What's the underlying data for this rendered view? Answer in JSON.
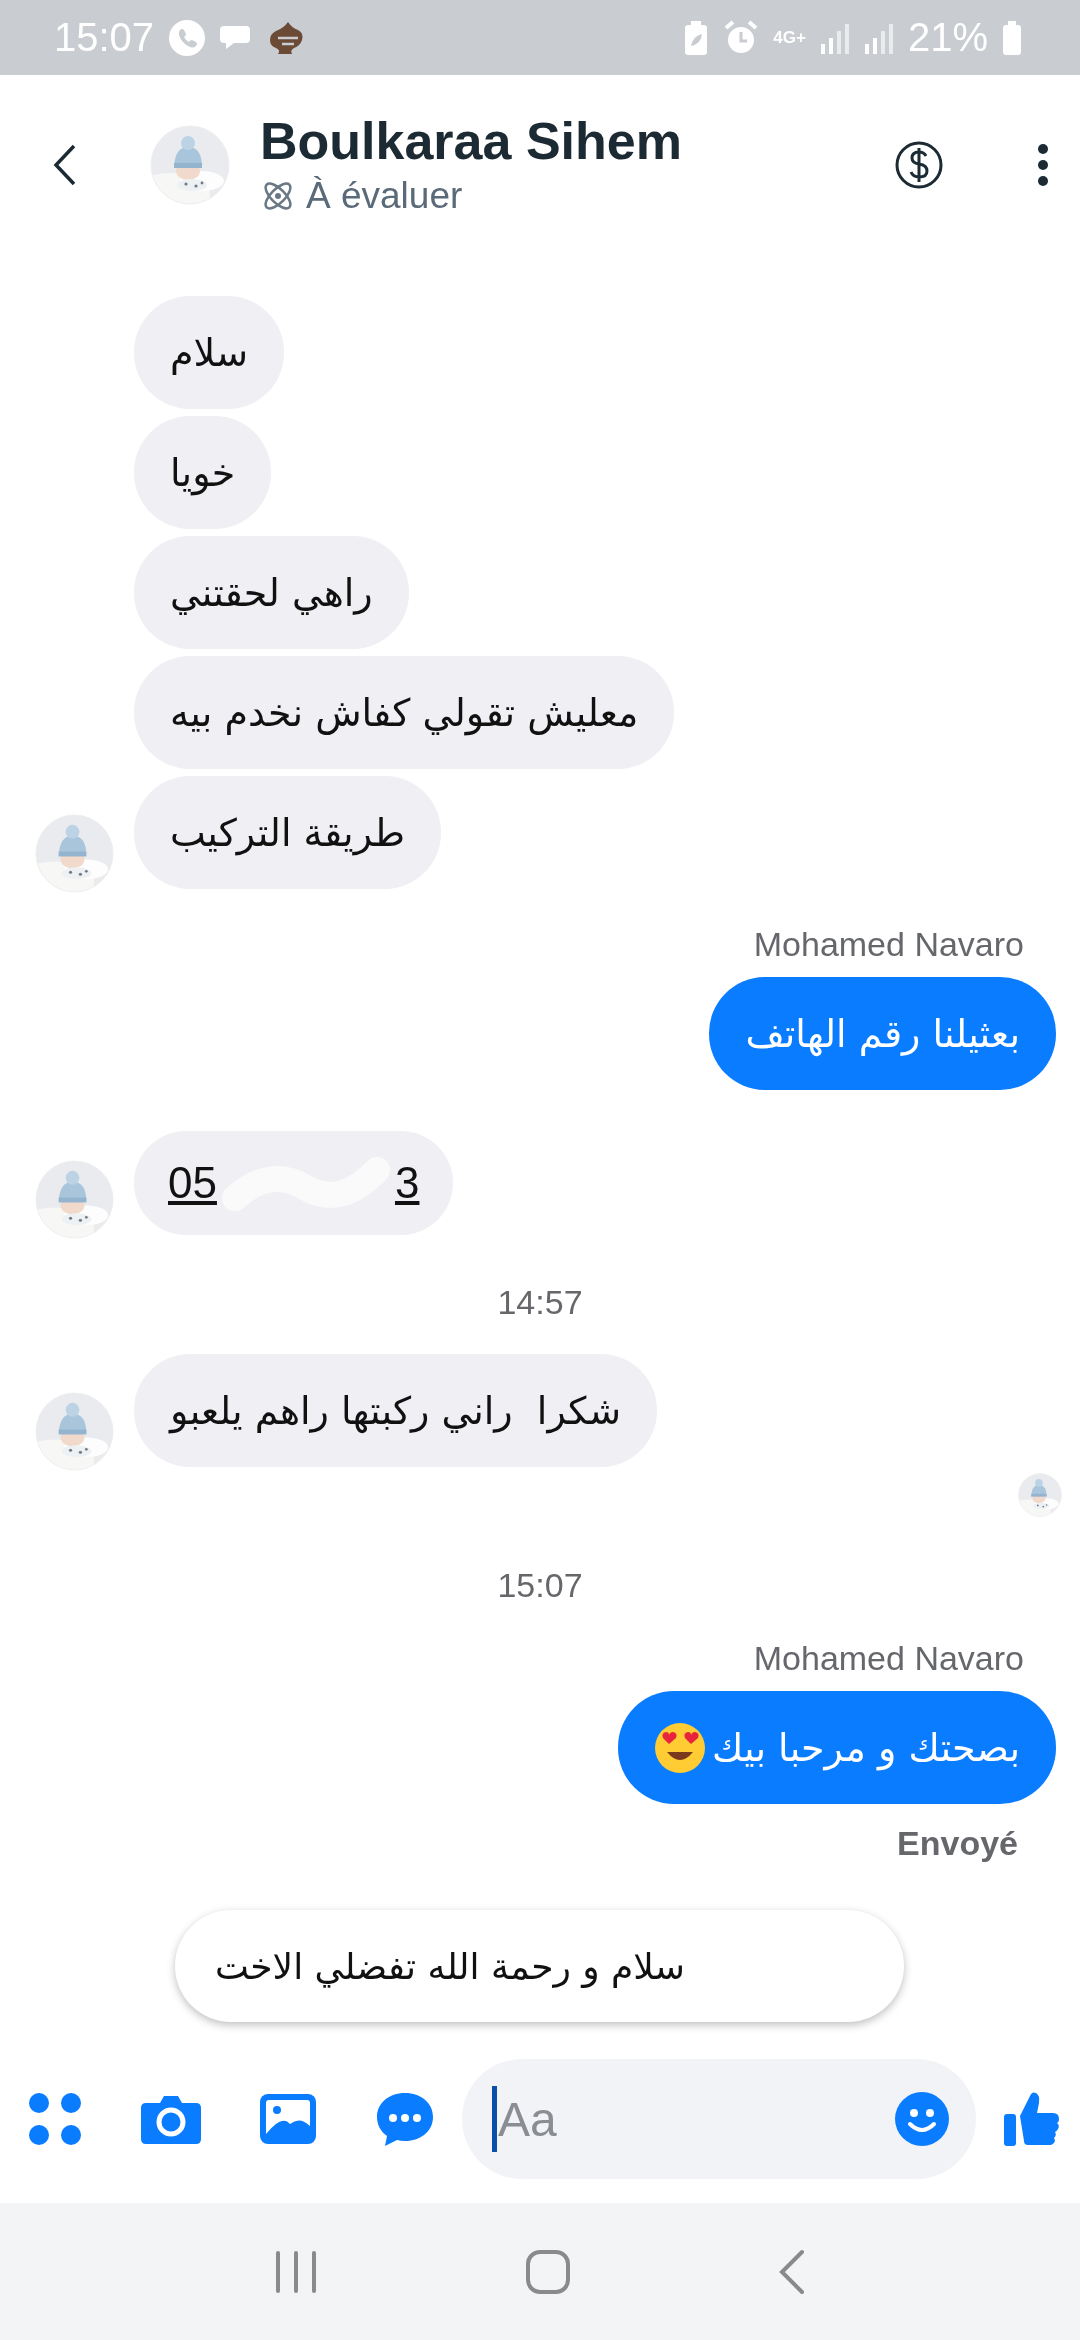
{
  "status_bar": {
    "time": "15:07",
    "network": "4G+",
    "battery": "21%"
  },
  "header": {
    "name": "Boulkaraa Sihem",
    "status": "À évaluer"
  },
  "messages": [
    {
      "kind": "received",
      "text": "سلام",
      "avatar": false
    },
    {
      "kind": "received",
      "text": "خويا",
      "avatar": false
    },
    {
      "kind": "received",
      "text": "راهي لحقتني",
      "avatar": false
    },
    {
      "kind": "received",
      "text": "معليش تقولي كفاش نخدم بيه",
      "avatar": false
    },
    {
      "kind": "received",
      "text": "طريقة التركيب",
      "avatar": true
    },
    {
      "kind": "sender_label",
      "text": "Mohamed Navaro"
    },
    {
      "kind": "sent",
      "text": "بعثيلنا رقم الهاتف",
      "emoji": false
    },
    {
      "kind": "phone",
      "start": "05",
      "end": "3",
      "avatar": true
    },
    {
      "kind": "timestamp",
      "text": "14:57"
    },
    {
      "kind": "received",
      "text": "شكرا  راني ركبتها راهم يلعبو",
      "avatar": true
    },
    {
      "kind": "seen"
    },
    {
      "kind": "timestamp",
      "text": "15:07"
    },
    {
      "kind": "sender_label",
      "text": "Mohamed Navaro"
    },
    {
      "kind": "sent",
      "text": "بصحتك و مرحبا بيك",
      "emoji": true
    },
    {
      "kind": "delivery",
      "text": "Envoyé"
    }
  ],
  "suggestion": "سلام و رحمة الله تفضلي الاخت",
  "composer": {
    "placeholder": "Aa"
  }
}
